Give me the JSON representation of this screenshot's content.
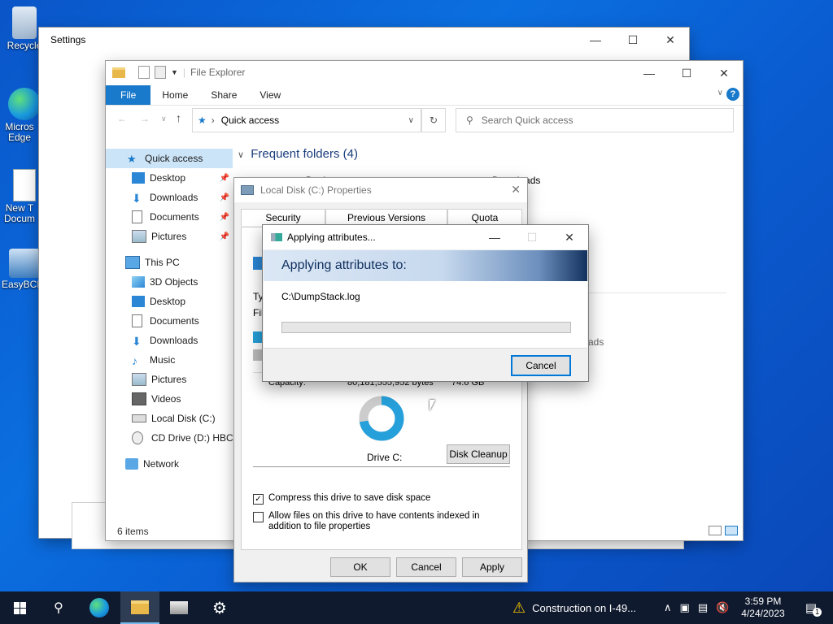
{
  "desktop": {
    "icons": [
      {
        "label": "Recycle"
      },
      {
        "label": "Micros Edge"
      },
      {
        "label": "New T Docum"
      },
      {
        "label": "EasyBCD"
      }
    ]
  },
  "settings": {
    "title": "Settings"
  },
  "explorer": {
    "title": "File Explorer",
    "ribbon_tabs": [
      "File",
      "Home",
      "Share",
      "View"
    ],
    "address": "Quick access",
    "search_placeholder": "Search Quick access",
    "frequent_heading": "Frequent folders (4)",
    "status": "6 items",
    "partial_folder_1": "Deskt",
    "partial_folder_2": "Downloads",
    "partial_text": "ads",
    "nav": {
      "quick_access": "Quick access",
      "qa_items": [
        "Desktop",
        "Downloads",
        "Documents",
        "Pictures"
      ],
      "this_pc": "This PC",
      "pc_items": [
        "3D Objects",
        "Desktop",
        "Documents",
        "Downloads",
        "Music",
        "Pictures",
        "Videos",
        "Local Disk (C:)",
        "CD Drive (D:) HBCD"
      ],
      "network": "Network"
    }
  },
  "properties": {
    "title": "Local Disk (C:) Properties",
    "tabs": [
      "Security",
      "Previous Versions",
      "Quota"
    ],
    "partial_type": "Typ",
    "partial_file": "File",
    "capacity_label": "Capacity:",
    "capacity_bytes": "80,181,555,952 bytes",
    "capacity_size": "74.6 GB",
    "drive_label": "Drive C:",
    "disk_cleanup": "Disk Cleanup",
    "compress_label": "Compress this drive to save disk space",
    "compress_checked": true,
    "index_label": "Allow files on this drive to have contents indexed in addition to file properties",
    "index_checked": false,
    "ok": "OK",
    "cancel": "Cancel",
    "apply": "Apply",
    "used_color": "#26a0da",
    "free_color": "#cccccc"
  },
  "apply_dialog": {
    "title": "Applying attributes...",
    "heading": "Applying attributes to:",
    "file": "C:\\DumpStack.log",
    "progress_fraction": 0.0,
    "cancel": "Cancel"
  },
  "taskbar": {
    "notification": "Construction on I-49...",
    "time": "3:59 PM",
    "date": "4/24/2023",
    "action_center_count": "1"
  }
}
